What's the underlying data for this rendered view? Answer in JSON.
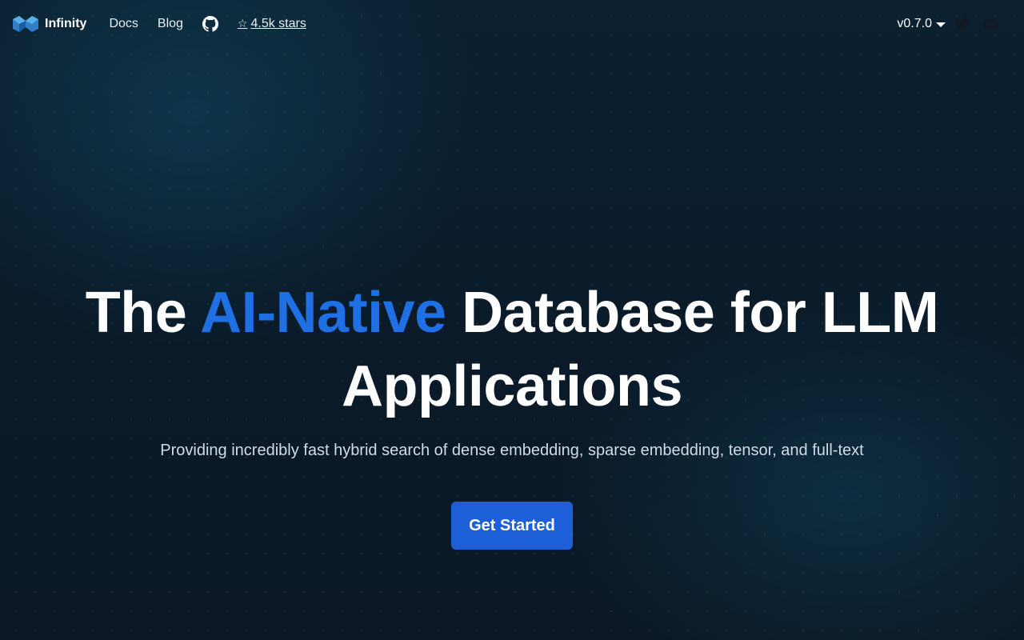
{
  "nav": {
    "brand": "Infinity",
    "links": [
      {
        "label": "Docs"
      },
      {
        "label": "Blog"
      }
    ],
    "github_icon": "github-icon",
    "stars": {
      "icon": "star-outline-icon",
      "label": "4.5k stars"
    },
    "version": "v0.7.0",
    "social_icons": [
      "twitter-icon",
      "discord-icon"
    ]
  },
  "hero": {
    "title_before": "The ",
    "title_accent": "AI-Native",
    "title_after": " Database for LLM Applications",
    "subtitle": "Providing incredibly fast hybrid search of dense embedding, sparse embedding, tensor, and full-text",
    "cta_label": "Get Started"
  },
  "colors": {
    "background": "#0c1a26",
    "accent": "#1f6fe5",
    "button": "#1d5fd6",
    "text": "#ffffff"
  }
}
